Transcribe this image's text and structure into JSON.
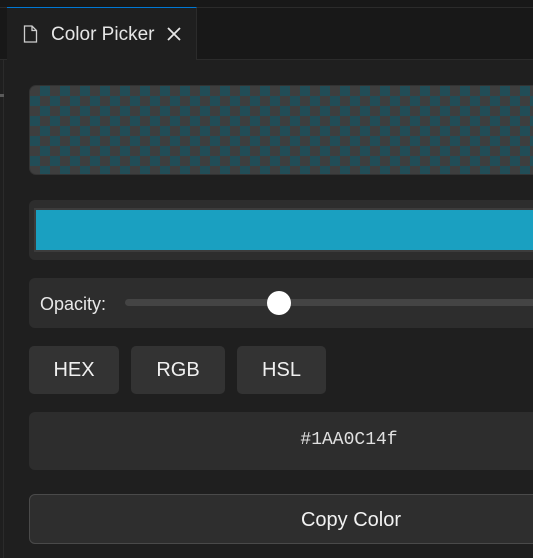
{
  "tab": {
    "title": "Color Picker",
    "icon": "file-icon",
    "close_icon": "close-icon"
  },
  "color": {
    "hex": "#1AA0C1",
    "value_display": "#1AA0C14f",
    "opacity_percent": 31,
    "checker_tint": "#214d57"
  },
  "opacity": {
    "label": "Opacity:"
  },
  "formats": [
    "HEX",
    "RGB",
    "HSL"
  ],
  "copy": {
    "label": "Copy Color"
  },
  "colors": {
    "accent": "#0078d4",
    "swatch": "#1aa0c1"
  }
}
